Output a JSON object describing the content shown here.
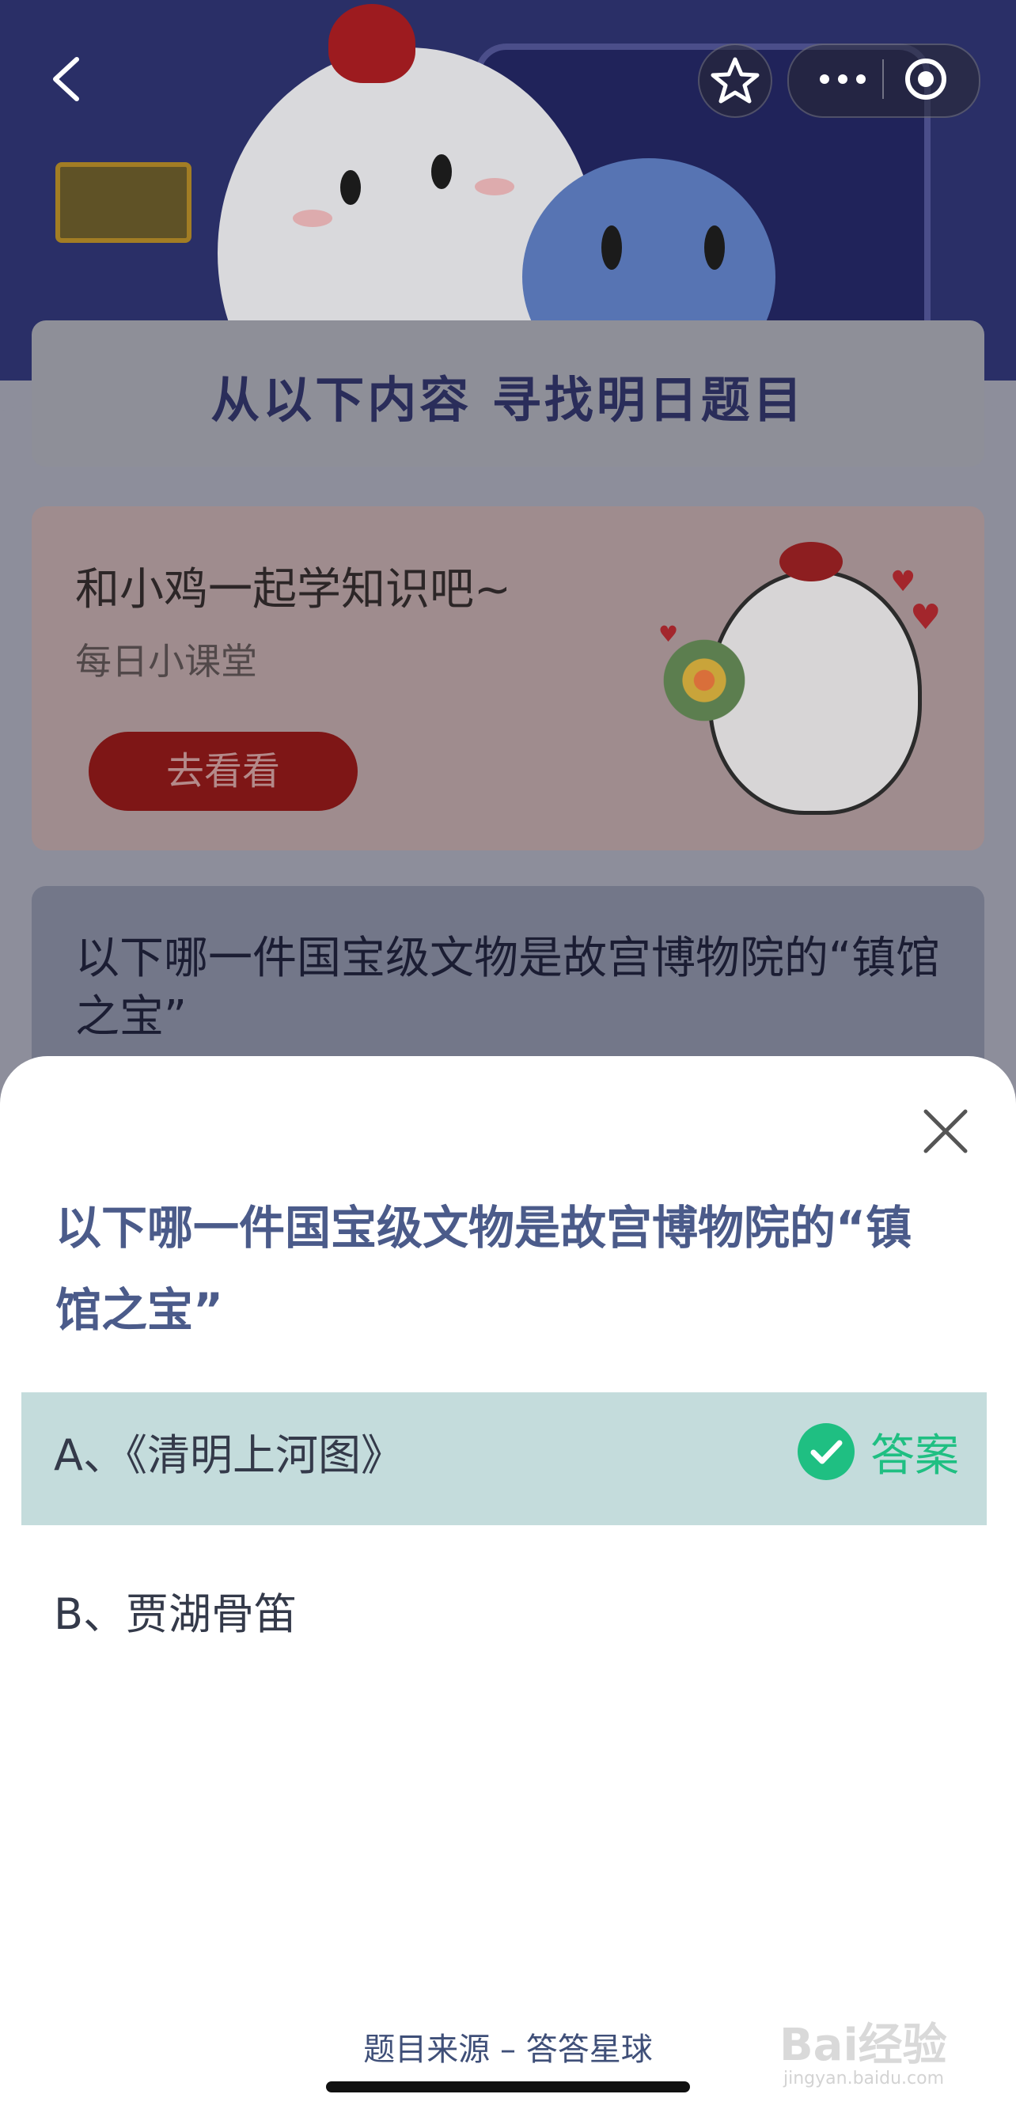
{
  "background": {
    "heading": "从以下内容 寻找明日题目",
    "promo": {
      "title": "和小鸡一起学知识吧~",
      "subtitle": "每日小课堂",
      "button": "去看看"
    },
    "question_preview": "以下哪一件国宝级文物是故宫博物院的“镇馆之宝”"
  },
  "navbar": {
    "icons": [
      "back-icon",
      "star-icon",
      "more-icon",
      "record-icon"
    ]
  },
  "sheet": {
    "question": "以下哪一件国宝级文物是故宫博物院的“镇馆之宝”",
    "options": [
      {
        "label": "A、《清明上河图》",
        "is_answer": true,
        "answer_tag": "答案"
      },
      {
        "label": "B、贾湖骨笛",
        "is_answer": false
      }
    ],
    "source": "题目来源 – 答答星球"
  },
  "watermark": {
    "text": "Bai经验",
    "sub": "jingyan.baidu.com"
  },
  "colors": {
    "answer_green": "#1fbf82",
    "question_blue": "#4b5b8a",
    "highlight": "#c4dcdc"
  }
}
